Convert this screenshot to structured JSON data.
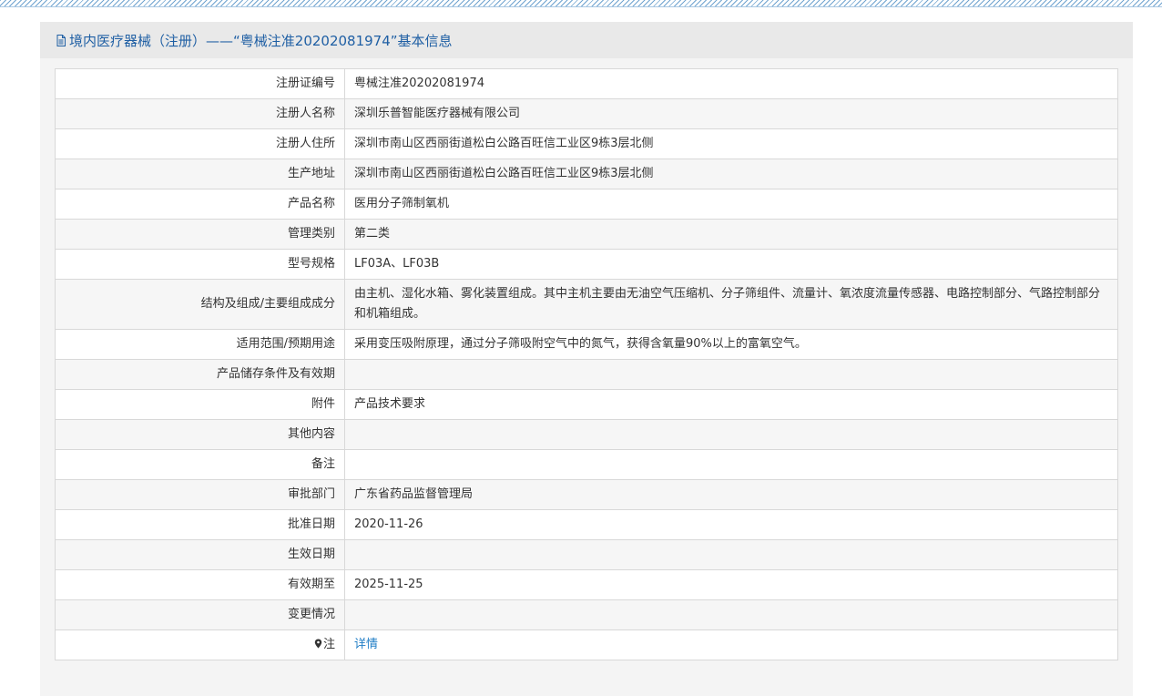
{
  "header": {
    "title": "境内医疗器械（注册）——“粤械注准20202081974”基本信息"
  },
  "rows": [
    {
      "label": "注册证编号",
      "value": "粤械注准20202081974"
    },
    {
      "label": "注册人名称",
      "value": "深圳乐普智能医疗器械有限公司"
    },
    {
      "label": "注册人住所",
      "value": "深圳市南山区西丽街道松白公路百旺信工业区9栋3层北侧"
    },
    {
      "label": "生产地址",
      "value": "深圳市南山区西丽街道松白公路百旺信工业区9栋3层北侧"
    },
    {
      "label": "产品名称",
      "value": "医用分子筛制氧机"
    },
    {
      "label": "管理类别",
      "value": "第二类"
    },
    {
      "label": "型号规格",
      "value": "LF03A、LF03B"
    },
    {
      "label": "结构及组成/主要组成成分",
      "value": "由主机、湿化水箱、雾化装置组成。其中主机主要由无油空气压缩机、分子筛组件、流量计、氧浓度流量传感器、电路控制部分、气路控制部分和机箱组成。"
    },
    {
      "label": "适用范围/预期用途",
      "value": "采用变压吸附原理，通过分子筛吸附空气中的氮气，获得含氧量90%以上的富氧空气。"
    },
    {
      "label": "产品储存条件及有效期",
      "value": ""
    },
    {
      "label": "附件",
      "value": "产品技术要求"
    },
    {
      "label": "其他内容",
      "value": ""
    },
    {
      "label": "备注",
      "value": ""
    },
    {
      "label": "审批部门",
      "value": "广东省药品监督管理局"
    },
    {
      "label": "批准日期",
      "value": "2020-11-26"
    },
    {
      "label": "生效日期",
      "value": ""
    },
    {
      "label": "有效期至",
      "value": "2025-11-25"
    },
    {
      "label": "变更情况",
      "value": ""
    }
  ],
  "note": {
    "label": "注",
    "link_text": "详情",
    "icon": "pin-icon"
  },
  "colors": {
    "header_text": "#1f5fa4",
    "link": "#1f7dc6",
    "border": "#d8d8d8"
  }
}
